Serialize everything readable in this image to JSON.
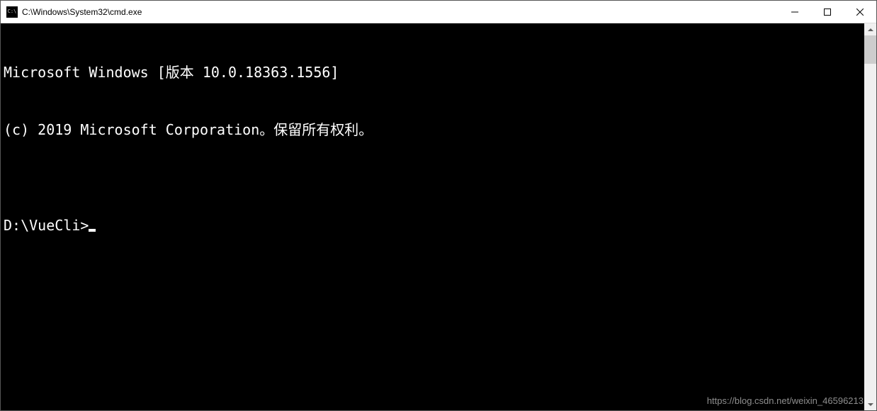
{
  "titlebar": {
    "icon_text": "C:\\",
    "title": "C:\\Windows\\System32\\cmd.exe"
  },
  "terminal": {
    "line1": "Microsoft Windows [版本 10.0.18363.1556]",
    "line2": "(c) 2019 Microsoft Corporation。保留所有权利。",
    "blank": "",
    "prompt": "D:\\VueCli>"
  },
  "watermark": "https://blog.csdn.net/weixin_46596213"
}
